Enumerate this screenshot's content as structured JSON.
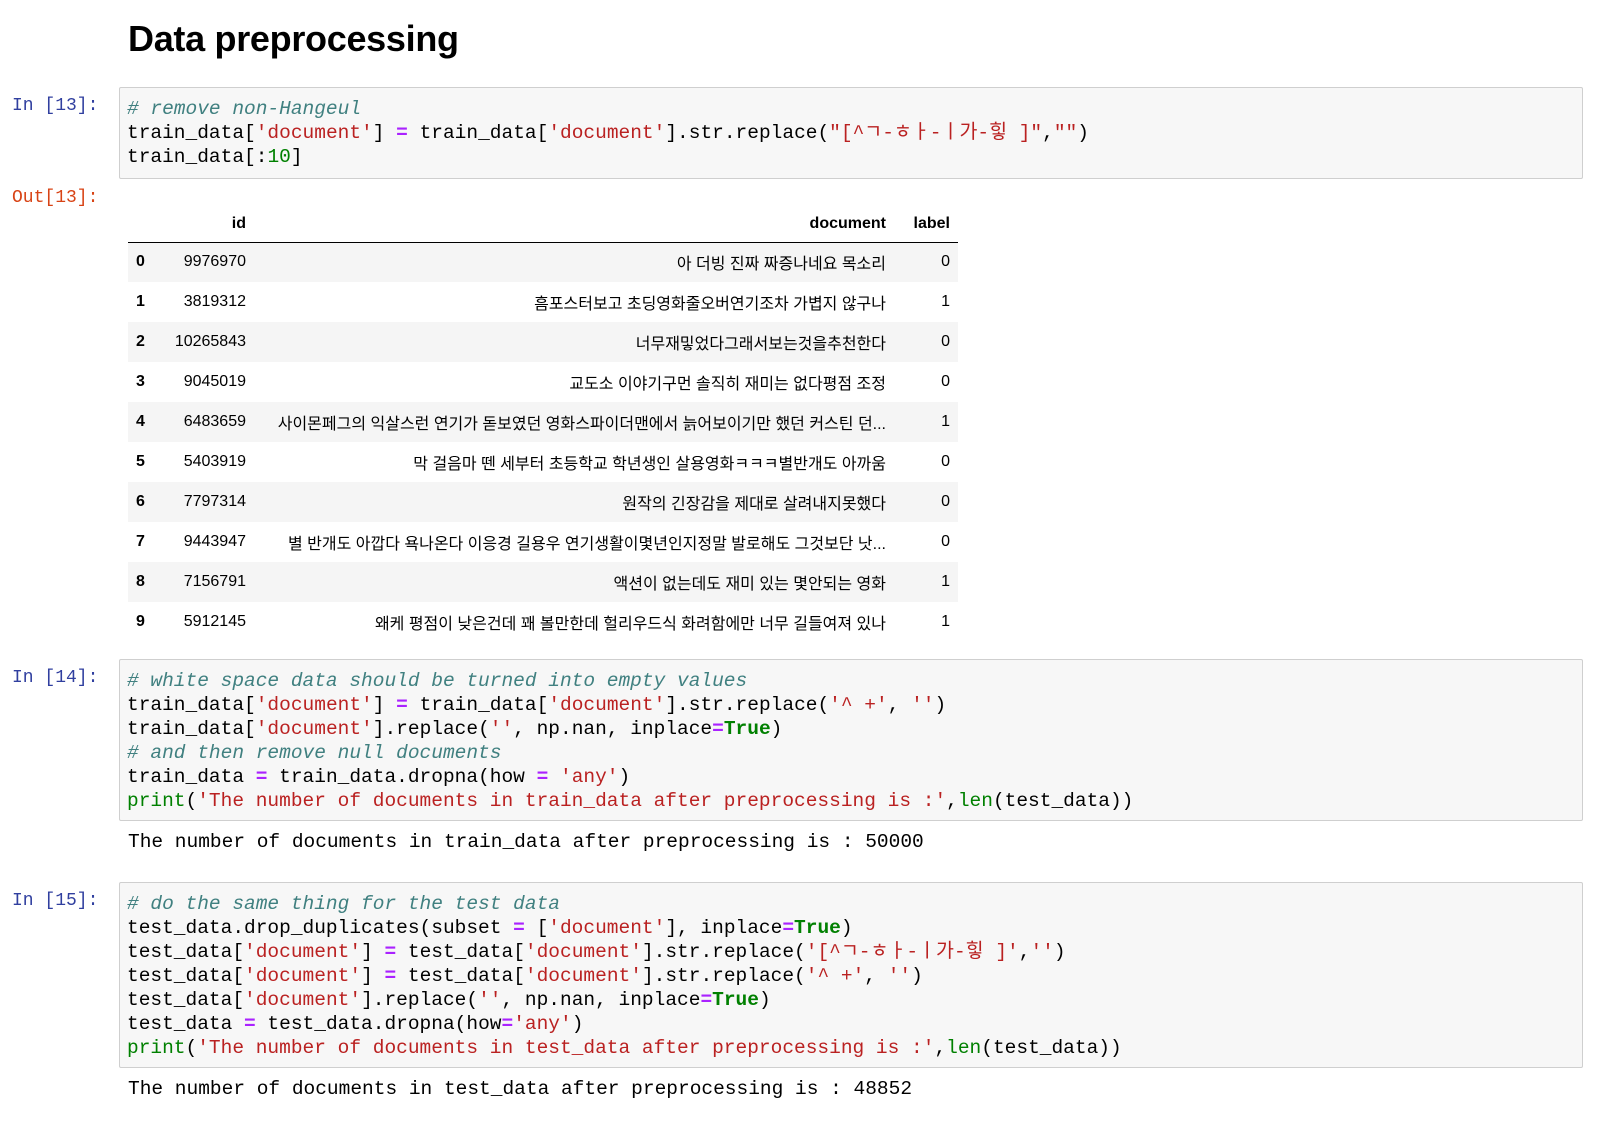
{
  "heading": "Data preprocessing",
  "cells": [
    {
      "prompt_in": "In [13]:",
      "prompt_out": "Out[13]:",
      "lines": [
        [
          [
            "cm",
            "# remove non-Hangeul"
          ]
        ],
        [
          [
            "t",
            "train_data["
          ],
          [
            "s",
            "'document'"
          ],
          [
            "t",
            "] "
          ],
          [
            "o",
            "="
          ],
          [
            "t",
            " train_data["
          ],
          [
            "s",
            "'document'"
          ],
          [
            "t",
            "].str.replace("
          ],
          [
            "s",
            "\"[^ㄱ-ㅎㅏ-ㅣ가-힣 ]\""
          ],
          [
            "t",
            ","
          ],
          [
            "s",
            "\"\""
          ],
          [
            "t",
            ")"
          ]
        ],
        [
          [
            "t",
            "train_data[:"
          ],
          [
            "n",
            "10"
          ],
          [
            "t",
            "]"
          ]
        ]
      ]
    },
    {
      "prompt_in": "In [14]:",
      "lines": [
        [
          [
            "cm",
            "# white space data should be turned into empty values"
          ]
        ],
        [
          [
            "t",
            "train_data["
          ],
          [
            "s",
            "'document'"
          ],
          [
            "t",
            "] "
          ],
          [
            "o",
            "="
          ],
          [
            "t",
            " train_data["
          ],
          [
            "s",
            "'document'"
          ],
          [
            "t",
            "].str.replace("
          ],
          [
            "s",
            "'^ +'"
          ],
          [
            "t",
            ", "
          ],
          [
            "s",
            "''"
          ],
          [
            "t",
            ")"
          ]
        ],
        [
          [
            "t",
            "train_data["
          ],
          [
            "s",
            "'document'"
          ],
          [
            "t",
            "].replace("
          ],
          [
            "s",
            "''"
          ],
          [
            "t",
            ", np.nan, inplace"
          ],
          [
            "o",
            "="
          ],
          [
            "k",
            "True"
          ],
          [
            "t",
            ")"
          ]
        ],
        [
          [
            "cm",
            "# and then remove null documents"
          ]
        ],
        [
          [
            "t",
            "train_data "
          ],
          [
            "o",
            "="
          ],
          [
            "t",
            " train_data.dropna(how "
          ],
          [
            "o",
            "="
          ],
          [
            "t",
            " "
          ],
          [
            "s",
            "'any'"
          ],
          [
            "t",
            ")"
          ]
        ],
        [
          [
            "nb",
            "print"
          ],
          [
            "t",
            "("
          ],
          [
            "s",
            "'The number of documents in train_data after preprocessing is :'"
          ],
          [
            "t",
            ","
          ],
          [
            "nb",
            "len"
          ],
          [
            "t",
            "(test_data))"
          ]
        ]
      ],
      "stdout": "The number of documents in train_data after preprocessing is : 50000"
    },
    {
      "prompt_in": "In [15]:",
      "lines": [
        [
          [
            "cm",
            "# do the same thing for the test data"
          ]
        ],
        [
          [
            "t",
            "test_data.drop_duplicates(subset "
          ],
          [
            "o",
            "="
          ],
          [
            "t",
            " ["
          ],
          [
            "s",
            "'document'"
          ],
          [
            "t",
            "], inplace"
          ],
          [
            "o",
            "="
          ],
          [
            "k",
            "True"
          ],
          [
            "t",
            ")"
          ]
        ],
        [
          [
            "t",
            "test_data["
          ],
          [
            "s",
            "'document'"
          ],
          [
            "t",
            "] "
          ],
          [
            "o",
            "="
          ],
          [
            "t",
            " test_data["
          ],
          [
            "s",
            "'document'"
          ],
          [
            "t",
            "].str.replace("
          ],
          [
            "s",
            "'[^ㄱ-ㅎㅏ-ㅣ가-힣 ]'"
          ],
          [
            "t",
            ","
          ],
          [
            "s",
            "''"
          ],
          [
            "t",
            ")"
          ]
        ],
        [
          [
            "t",
            "test_data["
          ],
          [
            "s",
            "'document'"
          ],
          [
            "t",
            "] "
          ],
          [
            "o",
            "="
          ],
          [
            "t",
            " test_data["
          ],
          [
            "s",
            "'document'"
          ],
          [
            "t",
            "].str.replace("
          ],
          [
            "s",
            "'^ +'"
          ],
          [
            "t",
            ", "
          ],
          [
            "s",
            "''"
          ],
          [
            "t",
            ")"
          ]
        ],
        [
          [
            "t",
            "test_data["
          ],
          [
            "s",
            "'document'"
          ],
          [
            "t",
            "].replace("
          ],
          [
            "s",
            "''"
          ],
          [
            "t",
            ", np.nan, inplace"
          ],
          [
            "o",
            "="
          ],
          [
            "k",
            "True"
          ],
          [
            "t",
            ")"
          ]
        ],
        [
          [
            "t",
            "test_data "
          ],
          [
            "o",
            "="
          ],
          [
            "t",
            " test_data.dropna(how"
          ],
          [
            "o",
            "="
          ],
          [
            "s",
            "'any'"
          ],
          [
            "t",
            ")"
          ]
        ],
        [
          [
            "nb",
            "print"
          ],
          [
            "t",
            "("
          ],
          [
            "s",
            "'The number of documents in test_data after preprocessing is :'"
          ],
          [
            "t",
            ","
          ],
          [
            "nb",
            "len"
          ],
          [
            "t",
            "(test_data))"
          ]
        ]
      ],
      "stdout": "The number of documents in test_data after preprocessing is : 48852"
    }
  ],
  "dataframe": {
    "columns": [
      "",
      "id",
      "document",
      "label"
    ],
    "rows": [
      [
        "0",
        "9976970",
        "아 더빙 진짜 짜증나네요 목소리",
        "0"
      ],
      [
        "1",
        "3819312",
        "흠포스터보고 초딩영화줄오버연기조차 가볍지 않구나",
        "1"
      ],
      [
        "2",
        "10265843",
        "너무재밓었다그래서보는것을추천한다",
        "0"
      ],
      [
        "3",
        "9045019",
        "교도소 이야기구먼 솔직히 재미는 없다평점 조정",
        "0"
      ],
      [
        "4",
        "6483659",
        "사이몬페그의 익살스런 연기가 돋보였던 영화스파이더맨에서 늙어보이기만 했던 커스틴 던...",
        "1"
      ],
      [
        "5",
        "5403919",
        "막 걸음마 뗀 세부터 초등학교 학년생인 살용영화ㅋㅋㅋ별반개도 아까움",
        "0"
      ],
      [
        "6",
        "7797314",
        "원작의 긴장감을 제대로 살려내지못했다",
        "0"
      ],
      [
        "7",
        "9443947",
        "별 반개도 아깝다 욕나온다 이응경 길용우 연기생활이몇년인지정말 발로해도 그것보단 낫...",
        "0"
      ],
      [
        "8",
        "7156791",
        "액션이 없는데도 재미 있는 몇안되는 영화",
        "1"
      ],
      [
        "9",
        "5912145",
        "왜케 평점이 낮은건데 꽤 볼만한데 헐리우드식 화려함에만 너무 길들여져 있나",
        "1"
      ]
    ]
  }
}
